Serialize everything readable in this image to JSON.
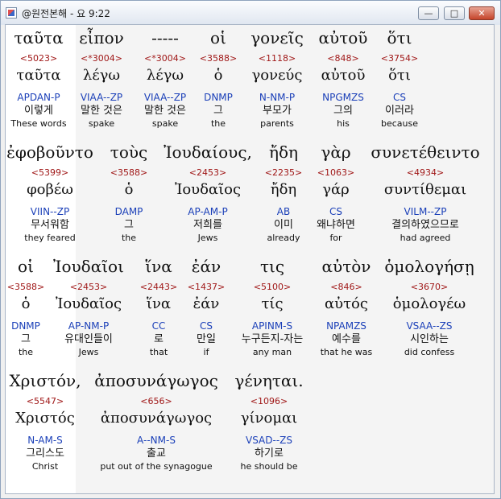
{
  "window": {
    "title": "@원전본해 - 요 9:22",
    "min_label": "—",
    "max_label": "□",
    "close_label": "✕"
  },
  "words": [
    {
      "greek": "ταῦτα",
      "strong": "<5023>",
      "lexeme": "ταῦτα",
      "parse": "APDAN-P",
      "korean": "이렇게",
      "english": "These words"
    },
    {
      "greek": "εἶπον",
      "strong": "<*3004>",
      "lexeme": "λέγω",
      "parse": "VIAA--ZP",
      "korean": "말한 것은",
      "english": "spake"
    },
    {
      "greek": "-----",
      "strong": "<*3004>",
      "lexeme": "λέγω",
      "parse": "VIAA--ZP",
      "korean": "말한 것은",
      "english": "spake"
    },
    {
      "greek": "οἱ",
      "strong": "<3588>",
      "lexeme": "ὁ",
      "parse": "DNMP",
      "korean": "그",
      "english": "the"
    },
    {
      "greek": "γονεῖς",
      "strong": "<1118>",
      "lexeme": "γονεύς",
      "parse": "N-NM-P",
      "korean": "부모가",
      "english": "parents"
    },
    {
      "greek": "αὐτοῦ",
      "strong": "<848>",
      "lexeme": "αὐτοῦ",
      "parse": "NPGMZS",
      "korean": "그의",
      "english": "his"
    },
    {
      "greek": "ὅτι",
      "strong": "<3754>",
      "lexeme": "ὅτι",
      "parse": "CS",
      "korean": "이러라",
      "english": "because"
    },
    {
      "greek": "ἐφοβοῦντο",
      "strong": "<5399>",
      "lexeme": "φοβέω",
      "parse": "VIIN--ZP",
      "korean": "무서워함",
      "english": "they feared"
    },
    {
      "greek": "τοὺς",
      "strong": "<3588>",
      "lexeme": "ὁ",
      "parse": "DAMP",
      "korean": "그",
      "english": "the"
    },
    {
      "greek": "Ἰουδαίους,",
      "strong": "<2453>",
      "lexeme": "Ἰουδαῖος",
      "parse": "AP-AM-P",
      "korean": "저희를",
      "english": "Jews"
    },
    {
      "greek": "ἤδη",
      "strong": "<2235>",
      "lexeme": "ἤδη",
      "parse": "AB",
      "korean": "이미",
      "english": "already"
    },
    {
      "greek": "γὰρ",
      "strong": "<1063>",
      "lexeme": "γάρ",
      "parse": "CS",
      "korean": "왜냐하면",
      "english": "for"
    },
    {
      "greek": "συνετέθειντο",
      "strong": "<4934>",
      "lexeme": "συντίθεμαι",
      "parse": "VILM--ZP",
      "korean": "결의하였으므로",
      "english": "had agreed"
    },
    {
      "greek": "οἱ",
      "strong": "<3588>",
      "lexeme": "ὁ",
      "parse": "DNMP",
      "korean": "그",
      "english": "the"
    },
    {
      "greek": "Ἰουδαῖοι",
      "strong": "<2453>",
      "lexeme": "Ἰουδαῖος",
      "parse": "AP-NM-P",
      "korean": "유대인들이",
      "english": "Jews"
    },
    {
      "greek": "ἵνα",
      "strong": "<2443>",
      "lexeme": "ἵνα",
      "parse": "CC",
      "korean": "로",
      "english": "that"
    },
    {
      "greek": "ἐάν",
      "strong": "<1437>",
      "lexeme": "ἐάν",
      "parse": "CS",
      "korean": "만일",
      "english": "if"
    },
    {
      "greek": "τις",
      "strong": "<5100>",
      "lexeme": "τίς",
      "parse": "APINM-S",
      "korean": "누구든지-자는",
      "english": "any man"
    },
    {
      "greek": "αὐτὸν",
      "strong": "<846>",
      "lexeme": "αὐτός",
      "parse": "NPAMZS",
      "korean": "예수를",
      "english": "that he was"
    },
    {
      "greek": "ὁμολογήσῃ",
      "strong": "<3670>",
      "lexeme": "ὁμολογέω",
      "parse": "VSAA--ZS",
      "korean": "시인하는",
      "english": "did confess"
    },
    {
      "greek": "Χριστόν,",
      "strong": "<5547>",
      "lexeme": "Χριστός",
      "parse": "N-AM-S",
      "korean": "그리스도",
      "english": "Christ"
    },
    {
      "greek": "ἀποσυνάγωγος",
      "strong": "<656>",
      "lexeme": "ἀποσυνάγωγος",
      "parse": "A--NM-S",
      "korean": "출교",
      "english": "put out of the synagogue"
    },
    {
      "greek": "γένηται.",
      "strong": "<1096>",
      "lexeme": "γίνομαι",
      "parse": "VSAD--ZS",
      "korean": "하기로",
      "english": "he should be"
    }
  ]
}
